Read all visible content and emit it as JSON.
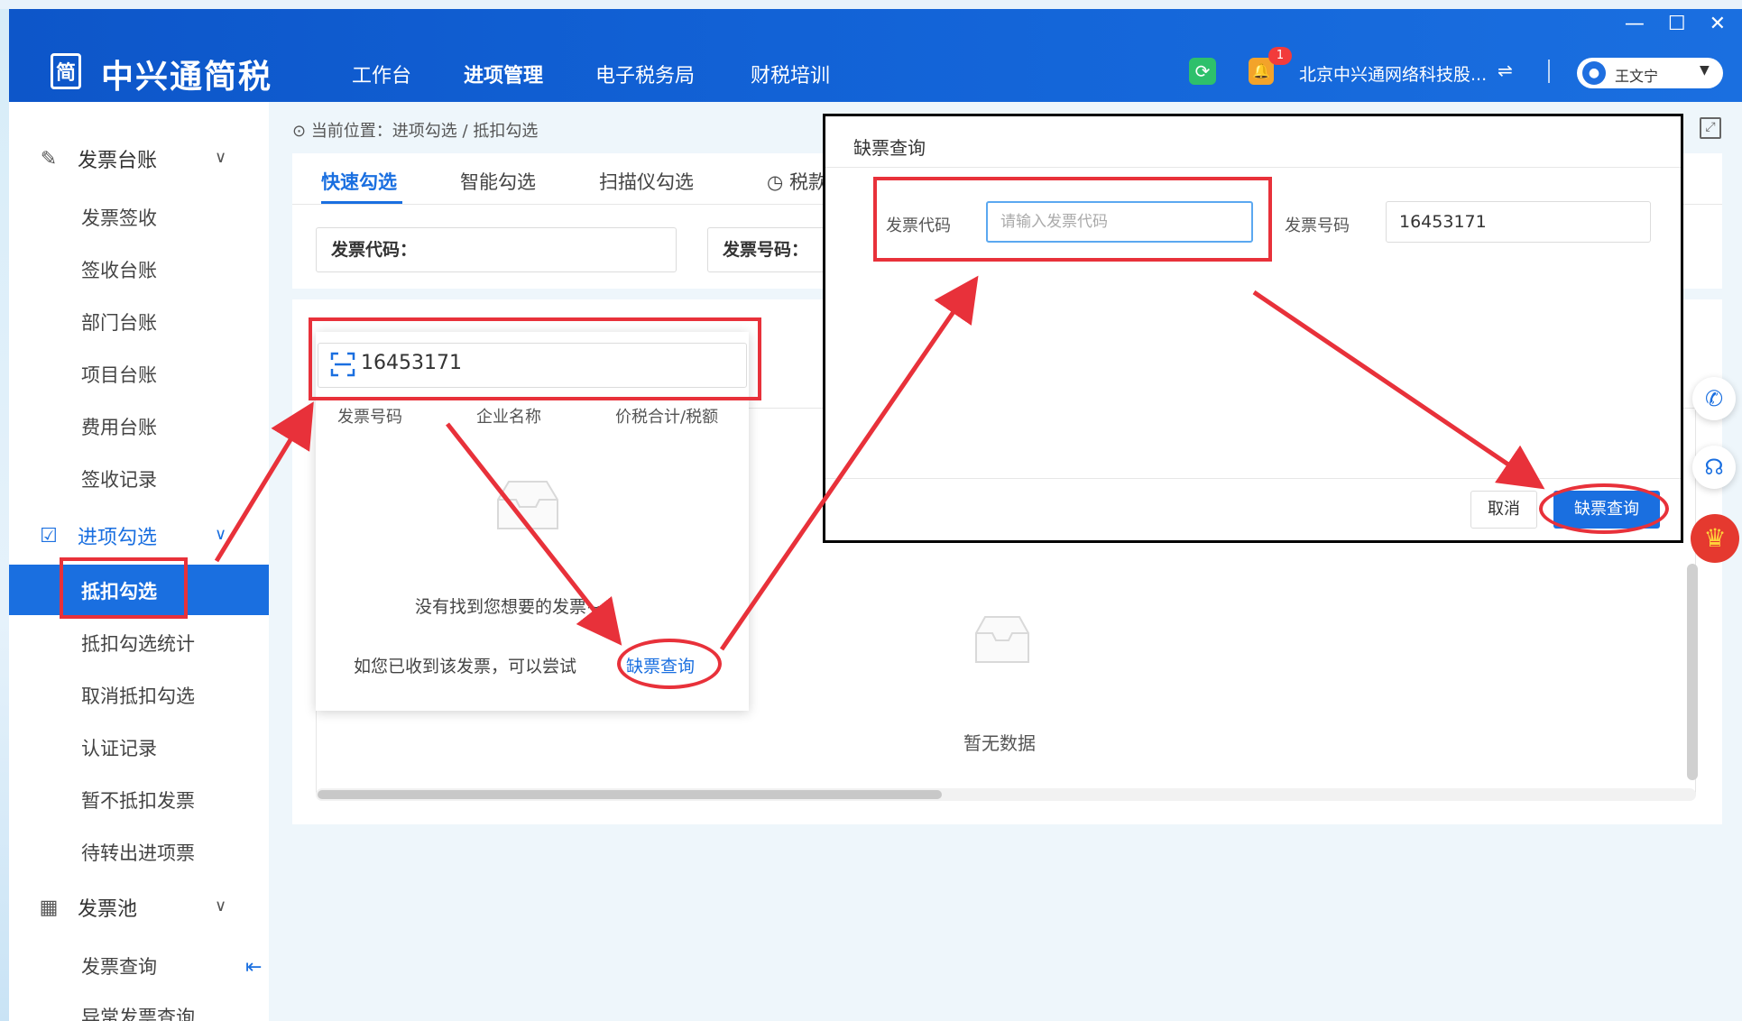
{
  "app": {
    "logo_glyph": "简",
    "name": "中兴通简税",
    "nav": [
      "工作台",
      "进项管理",
      "电子税务局",
      "财税培训"
    ],
    "company": "北京中兴通网络科技股...",
    "switch_icon": "⇌",
    "notification_count": "1",
    "user_name": "王文宁",
    "window_controls": [
      "—",
      "☐",
      "✕"
    ]
  },
  "sidebar": {
    "groups": [
      {
        "label": "发票台账",
        "icon": "edit-icon"
      },
      {
        "label": "进项勾选",
        "icon": "checkbox-icon"
      },
      {
        "label": "发票池",
        "icon": "grid-icon"
      }
    ],
    "invoice_ledger_items": [
      "发票签收",
      "签收台账",
      "部门台账",
      "项目台账",
      "费用台账",
      "签收记录"
    ],
    "input_select_items": [
      "抵扣勾选",
      "抵扣勾选统计",
      "取消抵扣勾选",
      "认证记录",
      "暂不抵扣发票",
      "待转出进项票"
    ],
    "invoice_pool_items": [
      "发票查询",
      "异常发票查询"
    ],
    "active_item": "抵扣勾选"
  },
  "breadcrumb": "当前位置：进项勾选 / 抵扣勾选",
  "tabs": [
    "快速勾选",
    "智能勾选",
    "扫描仪勾选",
    "税款"
  ],
  "filters": {
    "invoice_code_label": "发票代码：",
    "invoice_number_label": "发票号码："
  },
  "search_dropdown": {
    "value": "16453171",
    "columns": [
      "发票号码",
      "企业名称",
      "价税合计/税额"
    ],
    "empty_msg": "没有找到您想要的发票~~",
    "hint": "如您已收到该发票，可以尝试",
    "link": "缺票查询"
  },
  "table": {
    "empty_text": "暂无数据"
  },
  "dialog": {
    "title": "缺票查询",
    "code_label": "发票代码",
    "code_placeholder": "请输入发票代码",
    "number_label": "发票号码",
    "number_value": "16453171",
    "cancel": "取消",
    "confirm": "缺票查询"
  },
  "colors": {
    "primary": "#1a6fe0",
    "header": "#1262d6",
    "annotation": "#e8313a"
  }
}
